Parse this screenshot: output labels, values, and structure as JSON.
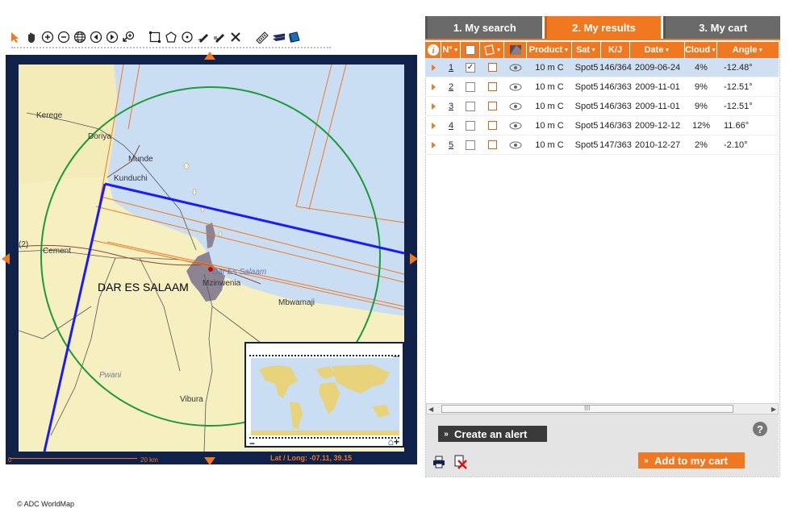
{
  "map": {
    "labels": {
      "kerege": "Kerege",
      "doriya": "Doriya",
      "munde": "Munde",
      "kunduchi": "Kunduchi",
      "cement": "Cement",
      "bunju": "(2)",
      "dar_es_salaam_city": "DAR ES SALAAM",
      "dar_es_salaam_water": "Dar Es Salaam",
      "mtoni": "Mzinwenia",
      "mbwamaji": "Mbwamaji",
      "pwani": "Pwani",
      "vibura": "Vibura"
    },
    "copyright": "© ADC WorldMap",
    "scale_start": "0",
    "scale_end": "20 km",
    "latlong": "Lat / Long: -07.11, 39.15"
  },
  "tabs": [
    {
      "label": "1. My search"
    },
    {
      "label": "2. My results"
    },
    {
      "label": "3. My cart"
    }
  ],
  "grid": {
    "headers": {
      "n": "N°",
      "product": "Product",
      "sat": "Sat",
      "kj": "K/J",
      "date": "Date",
      "cloud": "Cloud",
      "angle": "Angle"
    },
    "rows": [
      {
        "n": "1",
        "checked": "✓",
        "product": "10 m C",
        "sat": "Spot5",
        "kj": "146/364",
        "date": "2009-06-24",
        "cloud": "4%",
        "angle": "-12.48°"
      },
      {
        "n": "2",
        "checked": "",
        "product": "10 m C",
        "sat": "Spot5",
        "kj": "146/363",
        "date": "2009-11-01",
        "cloud": "9%",
        "angle": "-12.51°"
      },
      {
        "n": "3",
        "checked": "",
        "product": "10 m C",
        "sat": "Spot5",
        "kj": "146/363",
        "date": "2009-11-01",
        "cloud": "9%",
        "angle": "-12.51°"
      },
      {
        "n": "4",
        "checked": "",
        "product": "10 m C",
        "sat": "Spot5",
        "kj": "146/363",
        "date": "2009-12-12",
        "cloud": "12%",
        "angle": "11.66°"
      },
      {
        "n": "5",
        "checked": "",
        "product": "10 m C",
        "sat": "Spot5",
        "kj": "147/363",
        "date": "2010-12-27",
        "cloud": "2%",
        "angle": "-2.10°"
      }
    ]
  },
  "scroll_grip": "III",
  "actions": {
    "create_alert": "Create an alert",
    "add_to_cart": "Add to my cart",
    "help": "?"
  },
  "colors": {
    "accent": "#f07820",
    "frame": "#10214a",
    "footprint": "#1a1aff",
    "circle": "#1a9a3a",
    "selected_row": "#cfe0f3"
  }
}
